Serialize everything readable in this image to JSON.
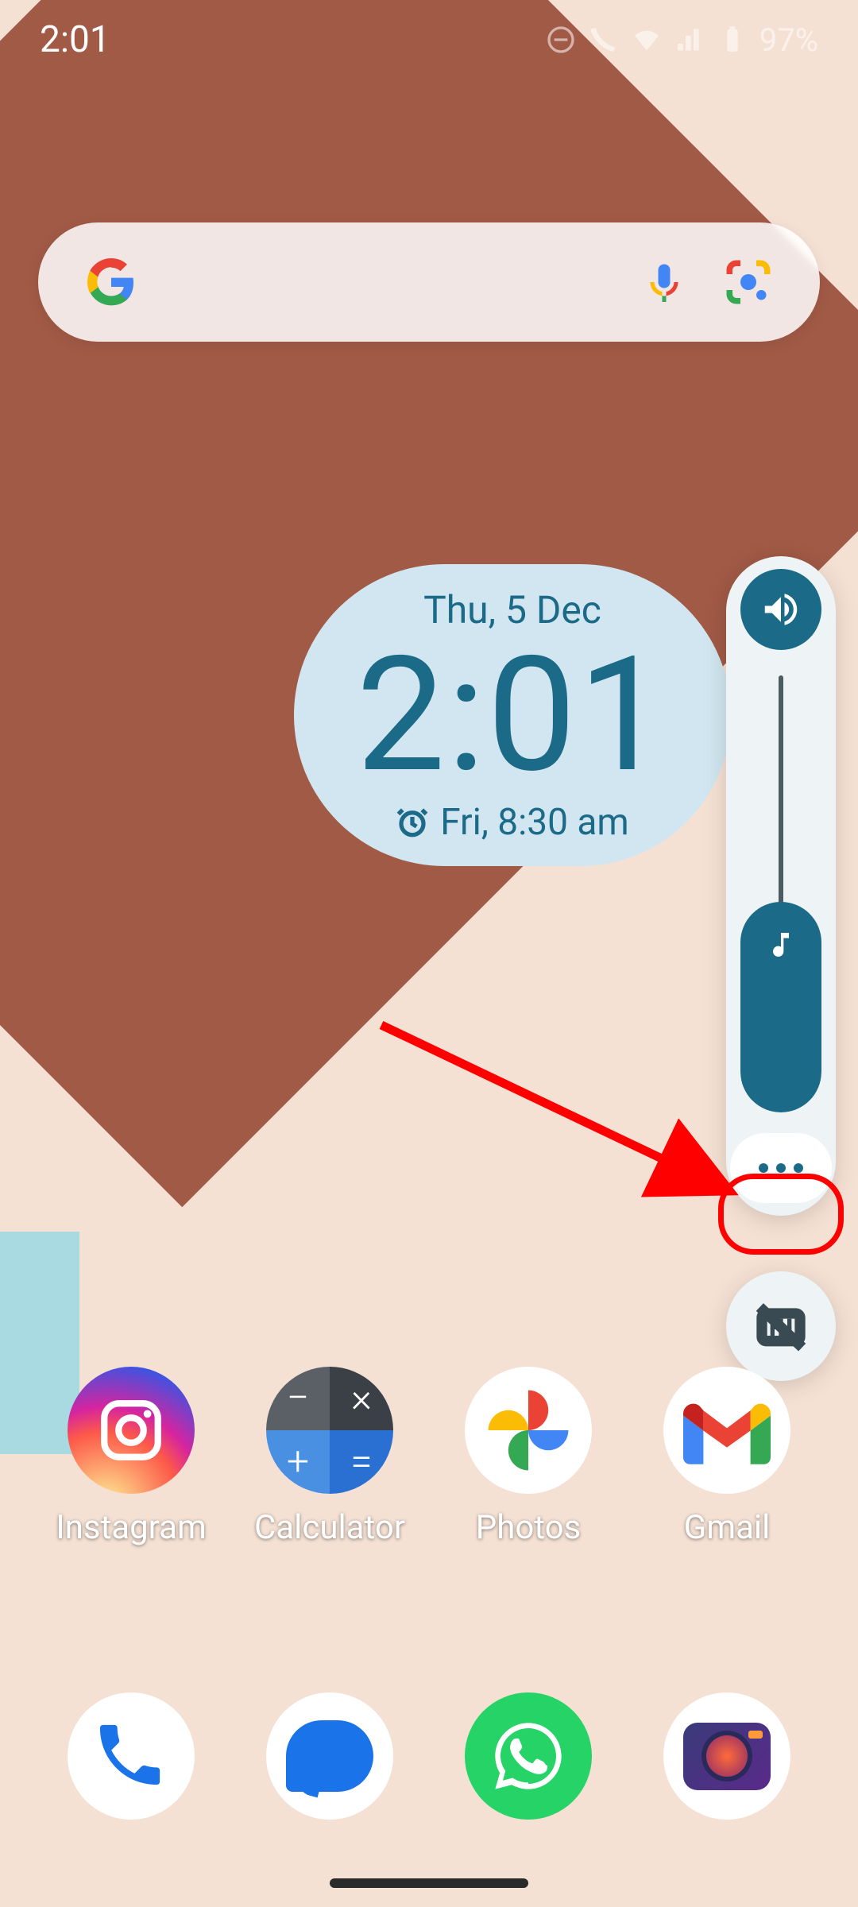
{
  "status": {
    "time": "2:01",
    "battery_pct": "97%"
  },
  "clock_widget": {
    "date": "Thu, 5 Dec",
    "time": "2:01",
    "alarm": "Fri, 8:30 am"
  },
  "volume_panel": {
    "level_pct": 48
  },
  "apps": {
    "row1": [
      {
        "label": "Instagram"
      },
      {
        "label": "Calculator"
      },
      {
        "label": "Photos"
      },
      {
        "label": "Gmail"
      }
    ]
  },
  "colors": {
    "accent": "#1b6a87",
    "panel_bg": "#eef4f5",
    "highlight": "#ff0000"
  }
}
